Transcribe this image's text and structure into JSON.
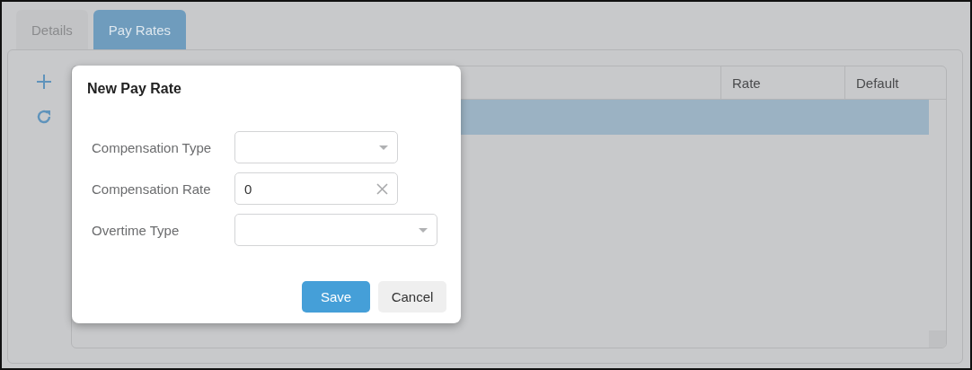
{
  "tabs": [
    {
      "label": "Details",
      "selected": false
    },
    {
      "label": "Pay Rates",
      "selected": true
    }
  ],
  "grid": {
    "columns": [
      {
        "label": "Rate"
      },
      {
        "label": "Default"
      }
    ],
    "rows": [
      {
        "selected": true
      }
    ]
  },
  "dialog": {
    "title": "New Pay Rate",
    "fields": [
      {
        "label": "Compensation Type",
        "kind": "select"
      },
      {
        "label": "Compensation Rate",
        "kind": "text",
        "value": "0",
        "clearable": true
      },
      {
        "label": "Overtime Type",
        "kind": "select"
      }
    ],
    "buttons": [
      {
        "label": "Save",
        "kind": "primary"
      },
      {
        "label": "Cancel",
        "kind": "secondary"
      }
    ]
  }
}
